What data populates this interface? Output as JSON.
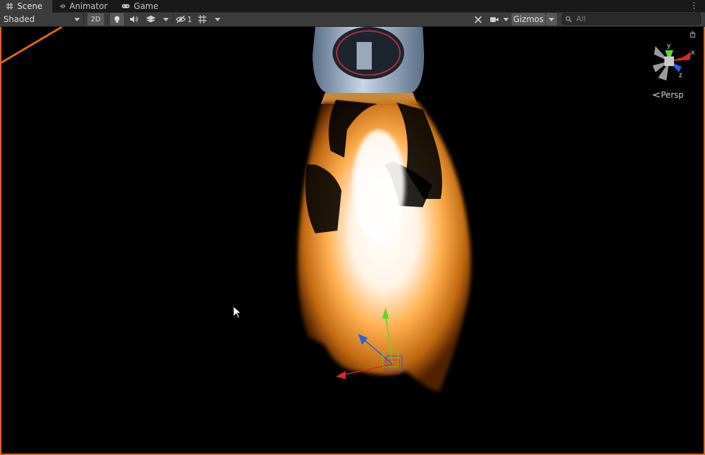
{
  "tabs": [
    {
      "label": "Scene",
      "icon": "grid-icon",
      "active": true
    },
    {
      "label": "Animator",
      "icon": "animator-icon",
      "active": false
    },
    {
      "label": "Game",
      "icon": "gamepad-icon",
      "active": false
    }
  ],
  "toolbar": {
    "shading_mode": "Shaded",
    "mode_2d": "2D",
    "hidden_count": "1",
    "gizmos_label": "Gizmos",
    "search_placeholder": "All"
  },
  "viewport": {
    "axis_labels": {
      "y": "y",
      "x": "x",
      "z": "z"
    },
    "projection_label": "Persp"
  },
  "colors": {
    "selection_outline": "#e0661c",
    "axis_x": "#d42a2a",
    "axis_y": "#5ed62a",
    "axis_z": "#2a5ee0"
  }
}
